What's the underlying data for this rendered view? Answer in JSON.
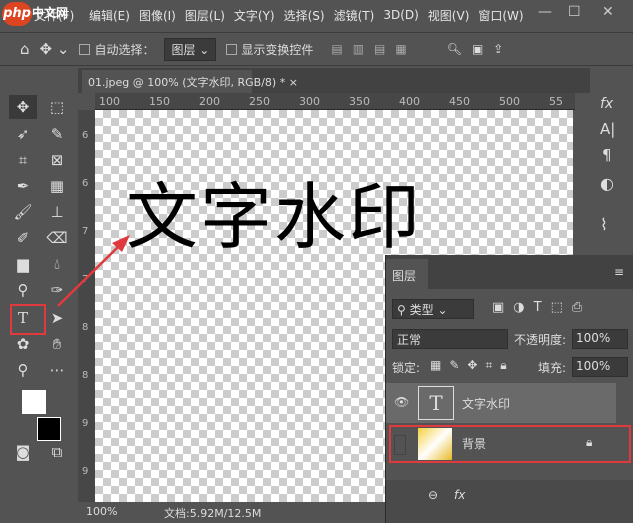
{
  "menu": {
    "logo": "php",
    "logo_sub": "中文网",
    "items": [
      "文件(F)",
      "编辑(E)",
      "图像(I)",
      "图层(L)",
      "文字(Y)",
      "选择(S)",
      "滤镜(T)",
      "3D(D)",
      "视图(V)",
      "窗口(W)"
    ]
  },
  "window": {
    "min": "—",
    "max": "☐",
    "close": "✕"
  },
  "options": {
    "auto_select_label": "自动选择：",
    "auto_select_value": "图层",
    "show_transform_label": "显示变换控件"
  },
  "document": {
    "tab_title": "01.jpeg @ 100% (文字水印, RGB/8) *",
    "close": "×",
    "canvas_text": "文字水印"
  },
  "rulers": {
    "h": [
      "100",
      "150",
      "200",
      "250",
      "300",
      "350",
      "400",
      "450",
      "500",
      "55"
    ],
    "v": [
      "6",
      "6",
      "7",
      "7",
      "8",
      "8",
      "9",
      "9"
    ]
  },
  "status": {
    "zoom": "100%",
    "doc": "文档:5.92M/12.5M"
  },
  "right_strip": {
    "icons": [
      "fx",
      "A|",
      "¶",
      "◐",
      "⌇"
    ]
  },
  "layers": {
    "tab": "图层",
    "filter": "类型",
    "blend": "正常",
    "opacity_label": "不透明度:",
    "opacity": "100%",
    "lock_label": "锁定:",
    "fill_label": "填充:",
    "fill": "100%",
    "items": [
      {
        "name": "文字水印",
        "visible": true,
        "type": "text"
      },
      {
        "name": "背景",
        "visible": false,
        "locked": true,
        "type": "image"
      }
    ],
    "footer": [
      "⊖",
      "fx"
    ]
  },
  "colors": {
    "highlight": "#e03a3e",
    "panel": "#535353"
  }
}
